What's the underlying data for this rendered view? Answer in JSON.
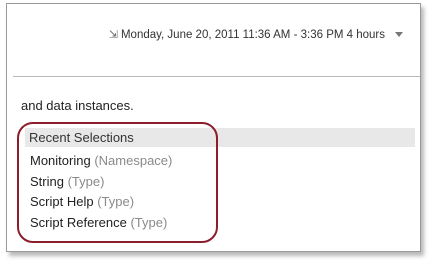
{
  "time_range": {
    "label": "Monday, June 20, 2011 11:36 AM - 3:36 PM 4 hours",
    "icon": "time-range-icon",
    "dropdown_icon": "chevron-down-icon"
  },
  "description_fragment": "and data instances.",
  "recent_selections": {
    "header": "Recent Selections",
    "items": [
      {
        "name": "Monitoring",
        "type": "(Namespace)"
      },
      {
        "name": "String",
        "type": "(Type)"
      },
      {
        "name": "Script Help",
        "type": "(Type)"
      },
      {
        "name": "Script Reference",
        "type": "(Type)"
      }
    ]
  },
  "colors": {
    "highlight_ring": "#8b1e2a",
    "header_background": "#e8e8e8",
    "type_text": "#8a8a8a"
  }
}
